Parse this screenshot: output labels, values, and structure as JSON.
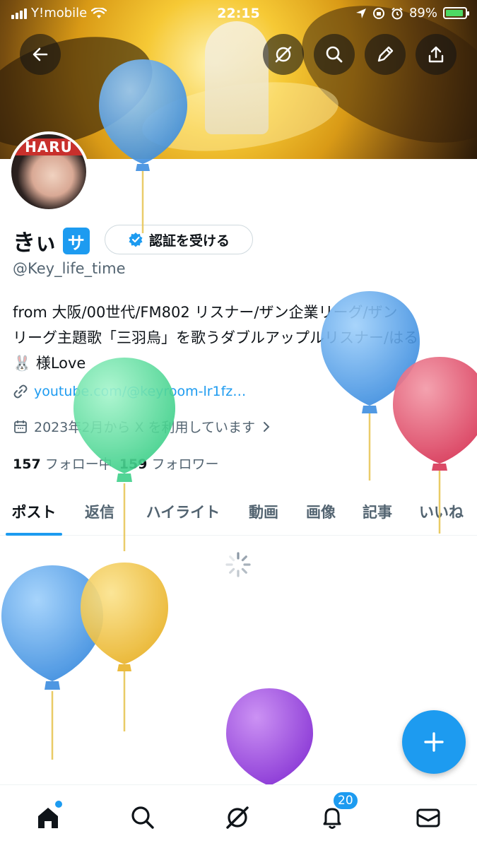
{
  "status_bar": {
    "carrier": "Y!mobile",
    "time": "22:15",
    "battery": "89%"
  },
  "header_actions": {
    "back_icon": "back-arrow-icon",
    "grok_icon": "grok-icon",
    "search_icon": "search-icon",
    "edit_icon": "pencil-icon",
    "share_icon": "share-icon"
  },
  "profile": {
    "avatar_text": "HARU",
    "name": "きぃ",
    "sub_badge": "サ",
    "verify_button": "認証を受ける",
    "handle": "@Key_life_time",
    "bio_line1": "from 大阪/00世代/FM802 リスナー/ザン企業リーグ/ザン",
    "bio_line2": "リーグ主題歌「三羽烏」を歌うダブルアップルリスナー/はる",
    "bio_line3": "🐰 様Love",
    "link": "youtube.com/@keyroom-lr1fz…",
    "joined": "2023年2月から X を利用しています",
    "following_count": "157",
    "following_label": "フォロー中",
    "followers_count": "159",
    "followers_label": "フォロワー"
  },
  "tabs": [
    "ポスト",
    "返信",
    "ハイライト",
    "動画",
    "画像",
    "記事",
    "いいね"
  ],
  "active_tab": "ポスト",
  "fab": {
    "icon": "plus-icon"
  },
  "bottom_nav": {
    "home_icon": "home-icon",
    "search_icon": "search-icon",
    "grok_icon": "grok-icon",
    "notifications_icon": "bell-icon",
    "notifications_count": "20",
    "messages_icon": "mail-icon"
  },
  "colors": {
    "accent": "#1d9bf0",
    "text_primary": "#0f1419",
    "text_secondary": "#536471",
    "balloon_blue": "#5aa9ee",
    "balloon_green": "#5fe3a3",
    "balloon_red": "#e8536f",
    "balloon_yellow": "#f5cc4a",
    "balloon_purple": "#a24ce3"
  }
}
